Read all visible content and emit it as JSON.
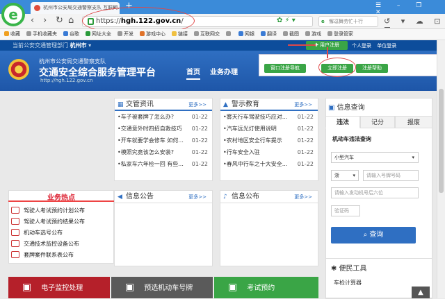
{
  "browser": {
    "tab_title": "杭州市公安局交通警察支队 互联网...",
    "tab_close": "×",
    "new_tab": "+",
    "url_scheme": "https://",
    "url_host": "hgh.122.gov.cn",
    "url_tail": "/",
    "search_placeholder": "懈逗舞劳忙十行",
    "logo_letter": "e",
    "window_controls": "☰ – ❐ ✕",
    "nav_back": "‹",
    "nav_forward": "›",
    "nav_refresh": "↻",
    "nav_home": "⌂",
    "right_nav": "↺ ▾ ☁ ⊡ ☰",
    "url_icons": "✿ ⚡ ▾"
  },
  "bookmarks": [
    {
      "label": "收藏",
      "color": "#f0a020"
    },
    {
      "label": "手机收藏夹",
      "color": "#999"
    },
    {
      "label": "谷歌",
      "color": "#3a7bd5"
    },
    {
      "label": "网址大全",
      "color": "#2a9a3a"
    },
    {
      "label": "开发",
      "color": "#999"
    },
    {
      "label": "游戏中心",
      "color": "#e0732a"
    },
    {
      "label": "链接",
      "color": "#f0c040"
    },
    {
      "label": "互联网交",
      "color": "#999"
    },
    {
      "label": "",
      "color": "#999"
    },
    {
      "label": "网银",
      "color": "#3a7bd5"
    },
    {
      "label": "翻译",
      "color": "#3a7bd5"
    },
    {
      "label": "截图",
      "color": "#999"
    },
    {
      "label": "游戏",
      "color": "#999"
    },
    {
      "label": "登录管家",
      "color": "#999"
    }
  ],
  "site": {
    "strip_text": "当前公安交通管理部门",
    "city": "杭州市",
    "city_arrow": "▾",
    "register": "✚ 用户注册",
    "personal_login": "个人登录",
    "unit_login": "单位登录",
    "org": "杭州市公安局交通警察支队",
    "title": "交通安全综合服务管理平台",
    "url": "http://hgh.122.gov.cn",
    "nav_home": "首页",
    "nav_business": "业务办理",
    "btn_window_guide": "窗口注册导航",
    "btn_register_now": "立即注册",
    "btn_register_help": "注册帮助"
  },
  "news": {
    "title": "交管资讯",
    "more": "更多>>",
    "items": [
      {
        "t": "•车子被套牌了怎么办?",
        "d": "01-22"
      },
      {
        "t": "•交通意外时四招自救技巧",
        "d": "01-22"
      },
      {
        "t": "•开车就要学会修车 如何...",
        "d": "01-22"
      },
      {
        "t": "•模照究竟该怎么安装?",
        "d": "01-22"
      },
      {
        "t": "•私家车六年检一回 有些...",
        "d": "01-22"
      }
    ]
  },
  "edu": {
    "title": "警示教育",
    "more": "更多>>",
    "items": [
      {
        "t": "•雾天行车驾驶技巧应对...",
        "d": "01-22"
      },
      {
        "t": "•汽车远光灯使用说明",
        "d": "01-22"
      },
      {
        "t": "•农村地区安全行车提示",
        "d": "01-22"
      },
      {
        "t": "•行车安全入驻",
        "d": "01-22"
      },
      {
        "t": "•春风中行车之十大安全...",
        "d": "01-22"
      }
    ]
  },
  "hot": {
    "title": "业务热点",
    "items": [
      "驾驶人考试预约计划公布",
      "驾驶人考试预约结果公布",
      "机动车选号公布",
      "交通技术监控设备公布",
      "套牌案件联系表公布"
    ]
  },
  "info": {
    "title": "信息公告",
    "more": "更多>>"
  },
  "notice": {
    "title": "信息公布",
    "more": "更多>>"
  },
  "query": {
    "title": "信息查询",
    "tabs": [
      "违法",
      "记分",
      "报废"
    ],
    "section": "机动车违法查询",
    "vehicle_type": "小型汽车",
    "province": "浙",
    "plate_placeholder": "请输入号牌号码",
    "engine_placeholder": "请输入发动机号后六位",
    "captcha_placeholder": "验证码",
    "submit": "查询"
  },
  "service": {
    "title": "便民工具",
    "item": "车检计算器"
  },
  "bottom": [
    {
      "label": "电子监控处理",
      "color": "#b5202a"
    },
    {
      "label": "预选机动车号牌",
      "color": "#5a5a5a"
    },
    {
      "label": "考试预约",
      "color": "#3aa546"
    }
  ],
  "totop": "▲"
}
